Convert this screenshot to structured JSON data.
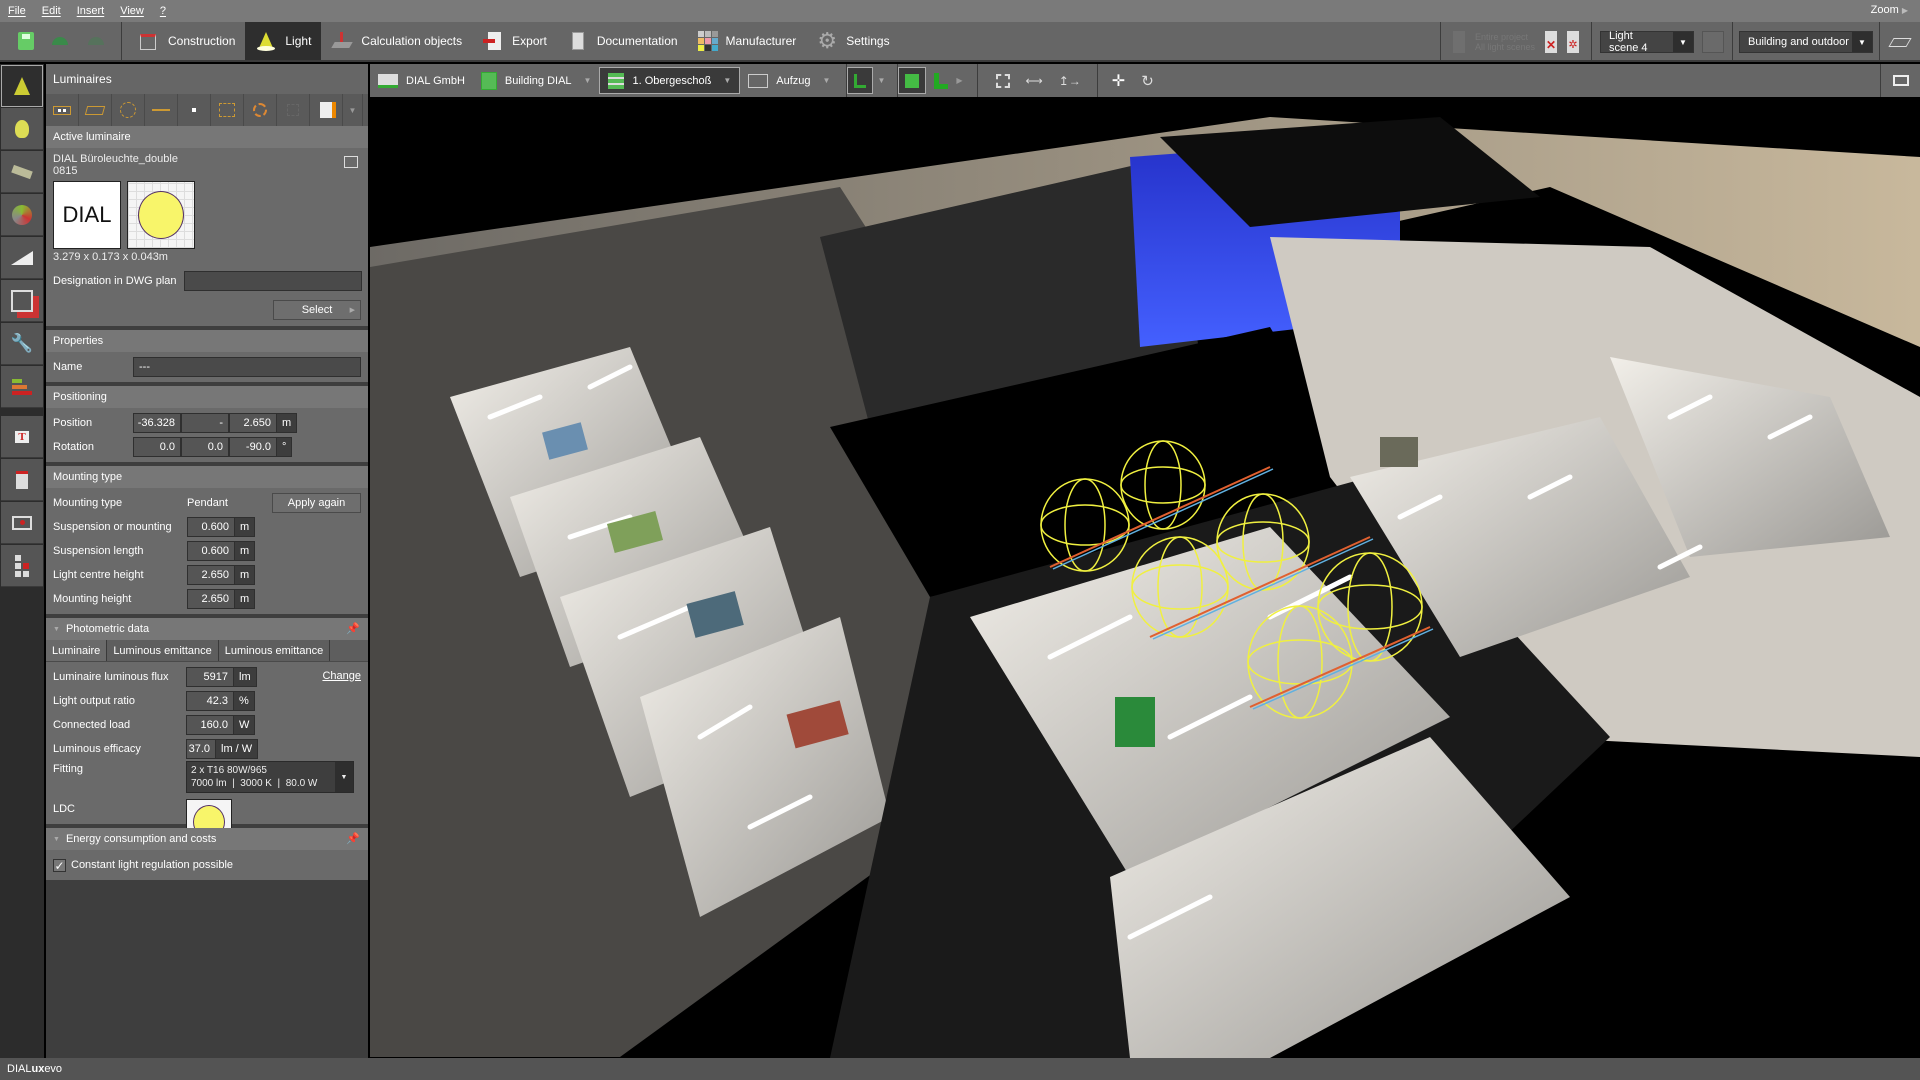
{
  "menu": {
    "items": [
      "File",
      "Edit",
      "Insert",
      "View",
      "?"
    ],
    "zoom_label": "Zoom"
  },
  "toolbar": {
    "modes": [
      {
        "label": "Construction",
        "icon": "construction-icon",
        "active": false
      },
      {
        "label": "Light",
        "icon": "light-icon",
        "active": true
      },
      {
        "label": "Calculation objects",
        "icon": "calculation-objects-icon",
        "active": false
      },
      {
        "label": "Export",
        "icon": "export-icon",
        "active": false
      },
      {
        "label": "Documentation",
        "icon": "documentation-icon",
        "active": false
      },
      {
        "label": "Manufacturer",
        "icon": "manufacturer-icon",
        "active": false
      },
      {
        "label": "Settings",
        "icon": "settings-gear-icon",
        "active": false
      }
    ],
    "scene_disabled_text_1": "Entire project",
    "scene_disabled_text_2": "All light scenes",
    "light_scene": "Light scene 4",
    "view_filter": "Building and outdoor pla..."
  },
  "viewbar": {
    "company": "DIAL GmbH",
    "building": "Building DIAL",
    "storey": "1. Obergeschoß",
    "object": "Aufzug"
  },
  "panel": {
    "title": "Luminaires",
    "active_luminaire": {
      "header": "Active luminaire",
      "name": "DIAL Büroleuchte_double",
      "number": "0815",
      "logo_text": "DIAL",
      "dimensions": "3.279 x 0.173 x 0.043m",
      "designation_label": "Designation in DWG plan",
      "designation_value": "",
      "select_label": "Select"
    },
    "properties": {
      "header": "Properties",
      "name_label": "Name",
      "name_value": "---"
    },
    "positioning": {
      "header": "Positioning",
      "position_label": "Position",
      "position": [
        "-36.328",
        "-",
        "2.650"
      ],
      "position_unit": "m",
      "rotation_label": "Rotation",
      "rotation": [
        "0.0",
        "0.0",
        "-90.0"
      ],
      "rotation_unit": "°"
    },
    "mounting": {
      "header": "Mounting type",
      "type_label": "Mounting type",
      "type_value": "Pendant",
      "apply_label": "Apply again",
      "rows": [
        {
          "label": "Suspension or mounting",
          "value": "0.600",
          "unit": "m"
        },
        {
          "label": "Suspension length",
          "value": "0.600",
          "unit": "m"
        },
        {
          "label": "Light centre height",
          "value": "2.650",
          "unit": "m"
        },
        {
          "label": "Mounting height",
          "value": "2.650",
          "unit": "m"
        }
      ]
    },
    "photometric": {
      "header": "Photometric data",
      "tabs": [
        "Luminaire",
        "Luminous emittance",
        "Luminous emittance"
      ],
      "change_label": "Change",
      "rows": [
        {
          "label": "Luminaire luminous flux",
          "value": "5917",
          "unit": "lm"
        },
        {
          "label": "Light output ratio",
          "value": "42.3",
          "unit": "%"
        },
        {
          "label": "Connected load",
          "value": "160.0",
          "unit": "W"
        },
        {
          "label": "Luminous efficacy",
          "value": "37.0",
          "unit": "lm / W"
        }
      ],
      "fitting_label": "Fitting",
      "fitting_line1": "2 x T16 80W/965",
      "fitting_line2": "7000 lm  |  3000 K  |  80.0 W",
      "ldc_label": "LDC"
    },
    "energy": {
      "header": "Energy consumption and costs",
      "checkbox_label": "Constant light regulation possible",
      "checked": true
    }
  },
  "statusbar": {
    "brand_a": "DIAL",
    "brand_b": "ux",
    "brand_c": "evo"
  }
}
